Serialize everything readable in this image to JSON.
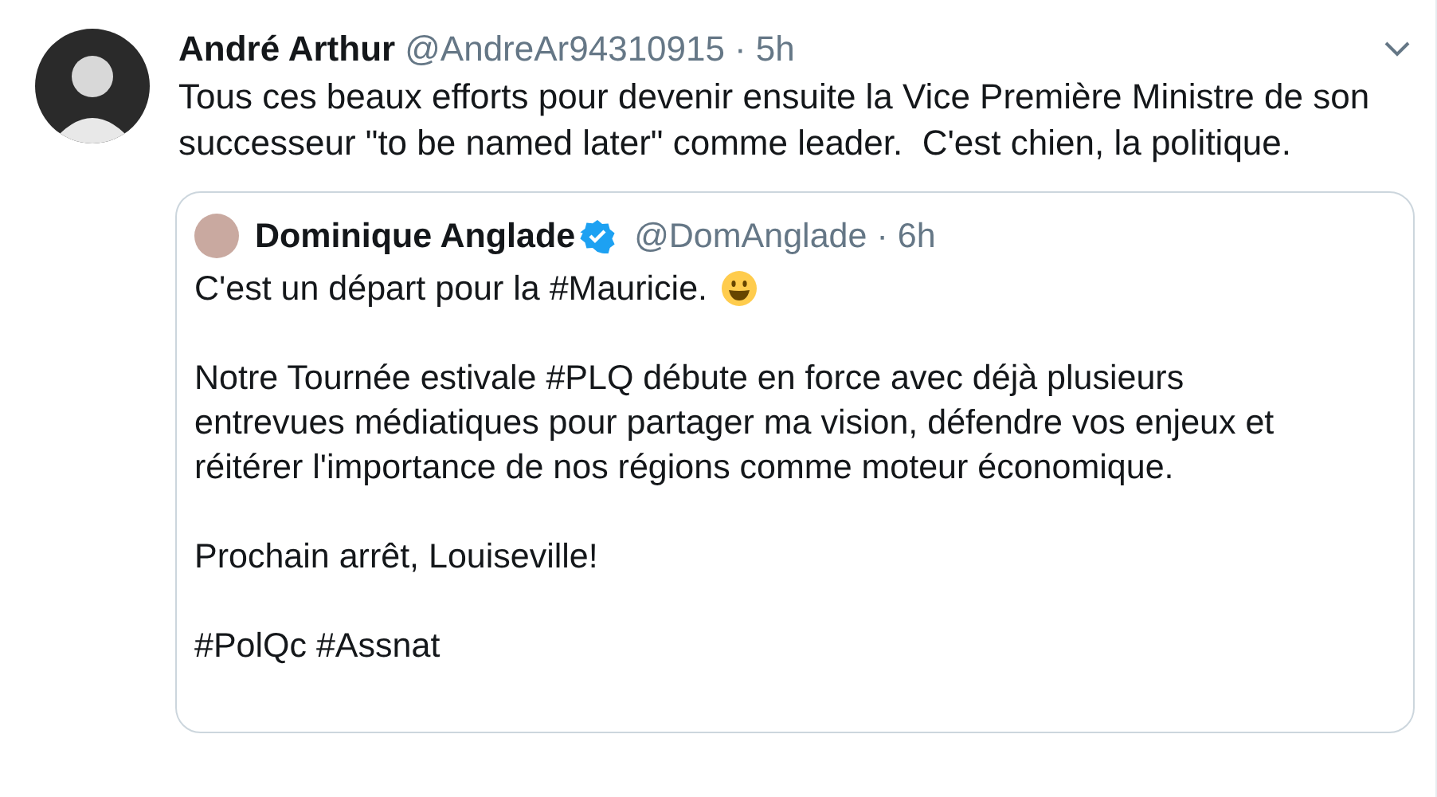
{
  "tweet": {
    "author": {
      "name": "André Arthur",
      "handle": "@AndreAr94310915",
      "separator": "·",
      "time": "5h"
    },
    "paragraphs": [
      "Tous ces beaux efforts pour devenir ensuite la Vice Première Ministre de son successeur \"to be named later\" comme leader.  C'est chien, la politique."
    ],
    "quoted": {
      "author": {
        "name": "Dominique Anglade",
        "verified": true,
        "handle": "@DomAnglade",
        "separator": "·",
        "time": "6h"
      },
      "paragraphs": [
        {
          "text": "C'est un départ pour la #Mauricie.",
          "emoji": true
        },
        {
          "text": "Notre Tournée estivale #PLQ débute en force avec déjà plusieurs entrevues médiatiques pour partager ma vision, défendre vos enjeux et réitérer l'importance de nos régions comme moteur économique.",
          "emoji": false
        },
        {
          "text": "Prochain arrêt, Louiseville!",
          "emoji": false
        },
        {
          "text": "#PolQc #Assnat",
          "emoji": false
        }
      ]
    }
  }
}
